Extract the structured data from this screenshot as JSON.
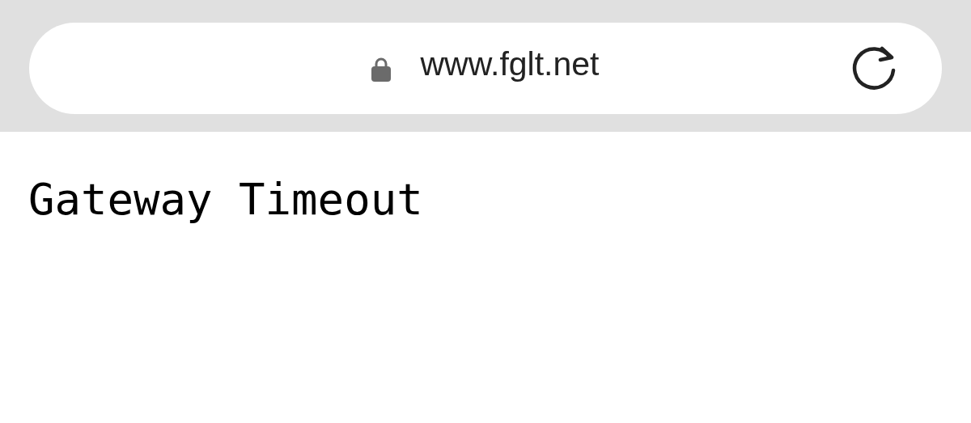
{
  "address_bar": {
    "url": "www.fglt.net"
  },
  "page": {
    "message": "Gateway Timeout"
  }
}
